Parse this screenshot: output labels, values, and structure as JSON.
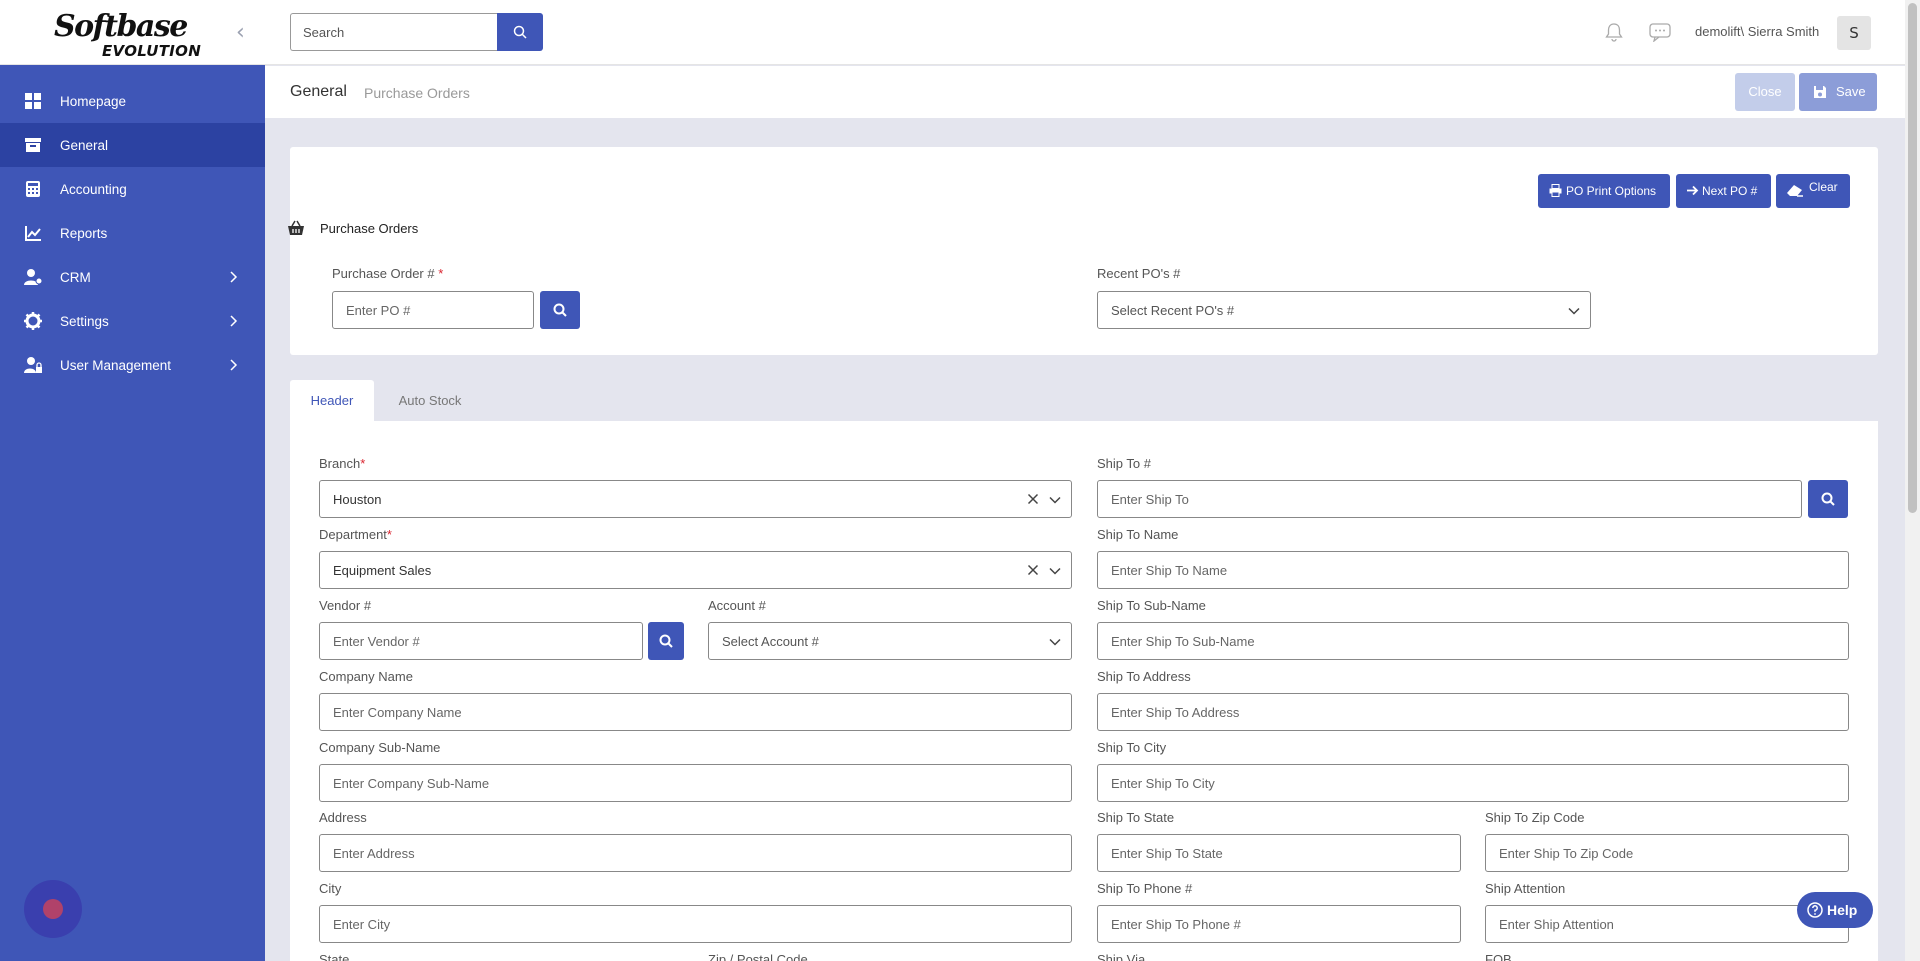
{
  "logo": {
    "line1": "Softbase",
    "line2": "EVOLUTION"
  },
  "sidebar": {
    "collapse_glyph": "‹",
    "items": [
      {
        "label": "Homepage",
        "icon": "dashboard-icon"
      },
      {
        "label": "General",
        "icon": "archive-icon"
      },
      {
        "label": "Accounting",
        "icon": "calculator-icon"
      },
      {
        "label": "Reports",
        "icon": "chart-line-icon"
      },
      {
        "label": "CRM",
        "icon": "users-gear-icon"
      },
      {
        "label": "Settings",
        "icon": "gear-icon"
      },
      {
        "label": "User Management",
        "icon": "user-lock-icon"
      }
    ]
  },
  "topbar": {
    "search_placeholder": "Search",
    "user_name": "demolift\\ Sierra Smith",
    "avatar_initial": "S"
  },
  "breadcrumb": {
    "title": "General",
    "sub": "Purchase Orders"
  },
  "actions": {
    "close": "Close",
    "save": "Save"
  },
  "po_card": {
    "print_options": "PO Print Options",
    "next_po": "Next PO #",
    "clear": "Clear",
    "section_title": "Purchase Orders",
    "po_label": "Purchase Order # ",
    "po_required": "*",
    "po_placeholder": "Enter PO #",
    "recent_label": "Recent PO's #",
    "recent_placeholder": "Select Recent PO's #"
  },
  "tabs": [
    {
      "label": "Header"
    },
    {
      "label": "Auto Stock"
    }
  ],
  "form": {
    "branch_label": "Branch",
    "branch_value": "Houston",
    "department_label": "Department",
    "department_value": "Equipment Sales",
    "required_mark": "*",
    "vendor_label": "Vendor #",
    "vendor_placeholder": "Enter Vendor #",
    "account_label": "Account #",
    "account_placeholder": "Select Account #",
    "company_name_label": "Company Name",
    "company_name_placeholder": "Enter Company Name",
    "company_sub_label": "Company Sub-Name",
    "company_sub_placeholder": "Enter Company Sub-Name",
    "address_label": "Address",
    "address_placeholder": "Enter Address",
    "city_label": "City",
    "city_placeholder": "Enter City",
    "state_label": "State",
    "zip_label": "Zip / Postal Code",
    "ship_to_label": "Ship To #",
    "ship_to_placeholder": "Enter Ship To",
    "ship_to_name_label": "Ship To Name",
    "ship_to_name_placeholder": "Enter Ship To Name",
    "ship_to_sub_label": "Ship To Sub-Name",
    "ship_to_sub_placeholder": "Enter Ship To Sub-Name",
    "ship_to_address_label": "Ship To Address",
    "ship_to_address_placeholder": "Enter Ship To Address",
    "ship_to_city_label": "Ship To City",
    "ship_to_city_placeholder": "Enter Ship To City",
    "ship_to_state_label": "Ship To State",
    "ship_to_state_placeholder": "Enter Ship To State",
    "ship_to_zip_label": "Ship To Zip Code",
    "ship_to_zip_placeholder": "Enter Ship To Zip Code",
    "ship_to_phone_label": "Ship To Phone #",
    "ship_to_phone_placeholder": "Enter Ship To Phone #",
    "ship_attention_label": "Ship Attention",
    "ship_attention_placeholder": "Enter Ship Attention",
    "ship_via_label": "Ship Via",
    "fob_label": "FOB"
  },
  "help": {
    "label": "Help"
  },
  "colors": {
    "primary": "#3f56b7",
    "sidebar_active": "#2c42a2",
    "required": "#d9232e",
    "page_bg": "#e4e5ee"
  }
}
